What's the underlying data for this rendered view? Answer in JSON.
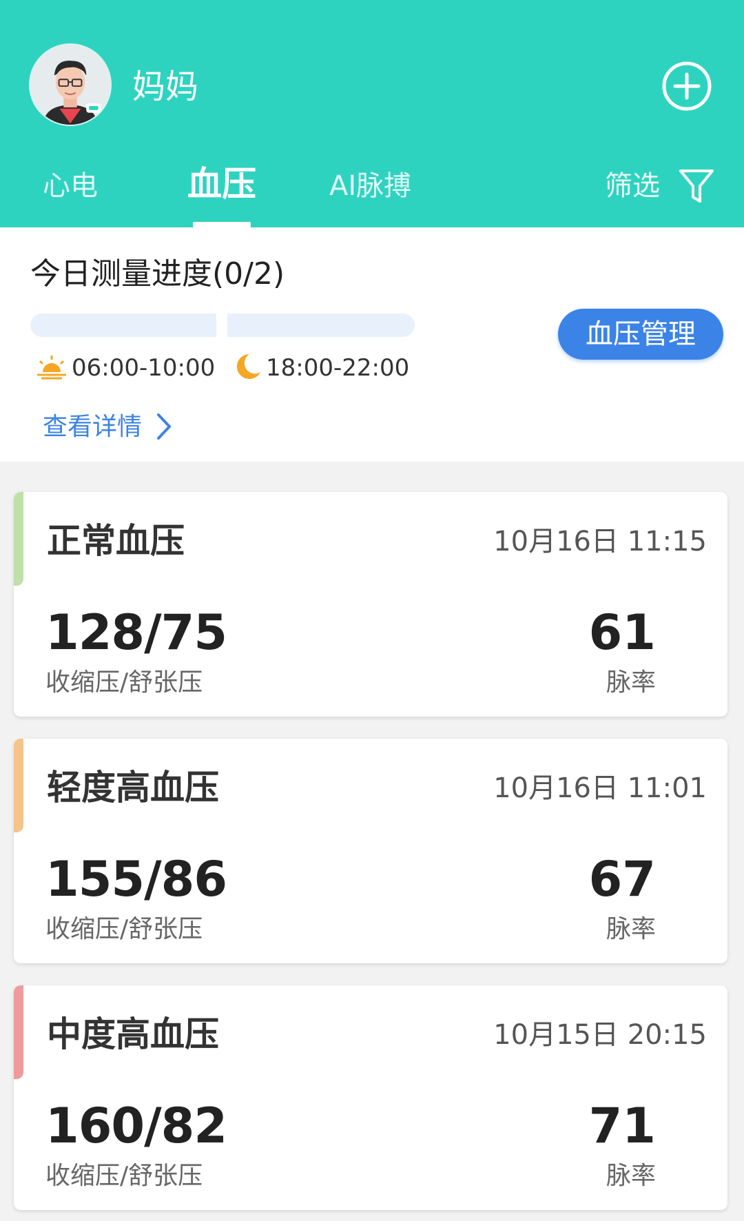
{
  "header": {
    "user_name": "妈妈",
    "tabs": [
      {
        "label": "心电"
      },
      {
        "label": "血压"
      },
      {
        "label": "AI脉搏"
      }
    ],
    "active_tab": "血压",
    "filter_label": "筛选"
  },
  "progress": {
    "title": "今日测量进度(0/2)",
    "completed_fraction": 0,
    "morning_slot": "06:00-10:00",
    "evening_slot": "18:00-22:00",
    "manage_button": "血压管理",
    "details_link": "查看详情"
  },
  "records": [
    {
      "status": "正常血压",
      "time": "10月16日 11:15",
      "bp": "128/75",
      "bp_label": "收缩压/舒张压",
      "pulse": "61",
      "pulse_label": "脉率",
      "accent": "#bfe0a8"
    },
    {
      "status": "轻度高血压",
      "time": "10月16日 11:01",
      "bp": "155/86",
      "bp_label": "收缩压/舒张压",
      "pulse": "67",
      "pulse_label": "脉率",
      "accent": "#f4c48a"
    },
    {
      "status": "中度高血压",
      "time": "10月15日 20:15",
      "bp": "160/82",
      "bp_label": "收缩压/舒张压",
      "pulse": "71",
      "pulse_label": "脉率",
      "accent": "#ee9b9b"
    }
  ],
  "colors": {
    "header_bg": "#2ed3c0",
    "primary_blue": "#3b83e7",
    "progress_track": "#e8f1fb"
  }
}
